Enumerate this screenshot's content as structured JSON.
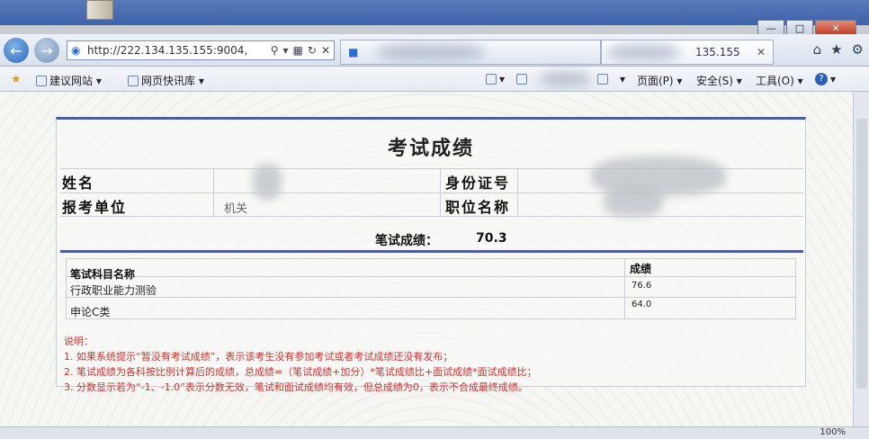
{
  "browser": {
    "url": "http://222.134.135.155:9004,",
    "tab2_text": "135.155",
    "window_controls": {
      "minimize": "—",
      "maximize": "□",
      "close": "✕"
    },
    "favorites": {
      "item1": "建议网站 ▾",
      "item2": "网页快讯库 ▾"
    },
    "menus": {
      "page": "页面(P) ▾",
      "safety": "安全(S) ▾",
      "tools": "工具(O) ▾"
    },
    "zoom": "100%"
  },
  "result": {
    "title": "考试成绩",
    "name_label": "姓名",
    "id_label": "身份证号",
    "unit_label": "报考单位",
    "unit_value": "机关",
    "position_label": "职位名称",
    "written_label": "笔试成绩：",
    "written_value": "70.3",
    "table": {
      "col_subject": "笔试科目名称",
      "col_score": "成绩",
      "rows": [
        {
          "subject": "行政职业能力测验",
          "score": "76.6"
        },
        {
          "subject": "申论C类",
          "score": "64.0"
        }
      ]
    },
    "notes": {
      "heading": "说明：",
      "line1": "1. 如果系统提示“暂没有考试成绩”，表示该考生没有参加考试或者考试成绩还没有发布；",
      "line2": "2. 笔试成绩为各科按比例计算后的成绩，总成绩=（笔试成绩+加分）*笔试成绩比+面试成绩*面试成绩比；",
      "line3": "3. 分数显示若为“-1、-1.0”表示分数无效，笔试和面试成绩均有效，但总成绩为0，表示不合成最终成绩。"
    }
  }
}
